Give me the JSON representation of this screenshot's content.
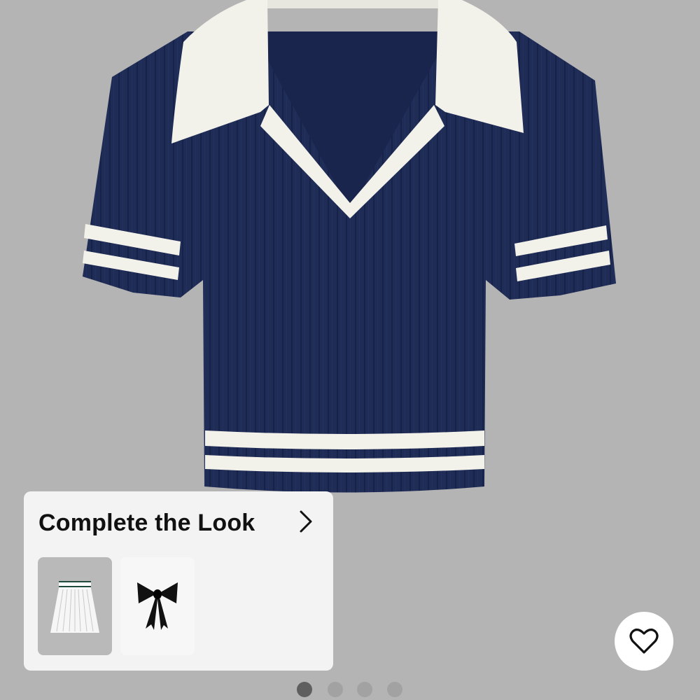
{
  "product": {
    "image_icon": "navy-ribbed-polo-crop-top",
    "colors": {
      "background": "#b4b4b4",
      "navy": "#1f2c55",
      "trim": "#f2f1ea"
    }
  },
  "complete_the_look": {
    "title": "Complete the Look",
    "more_icon": "chevron-right-icon",
    "items": [
      {
        "icon": "pleated-skirt-thumbnail"
      },
      {
        "icon": "black-bow-thumbnail"
      }
    ]
  },
  "favorite": {
    "icon": "heart-outline-icon"
  },
  "carousel": {
    "page_count": 4,
    "active_index": 0
  }
}
